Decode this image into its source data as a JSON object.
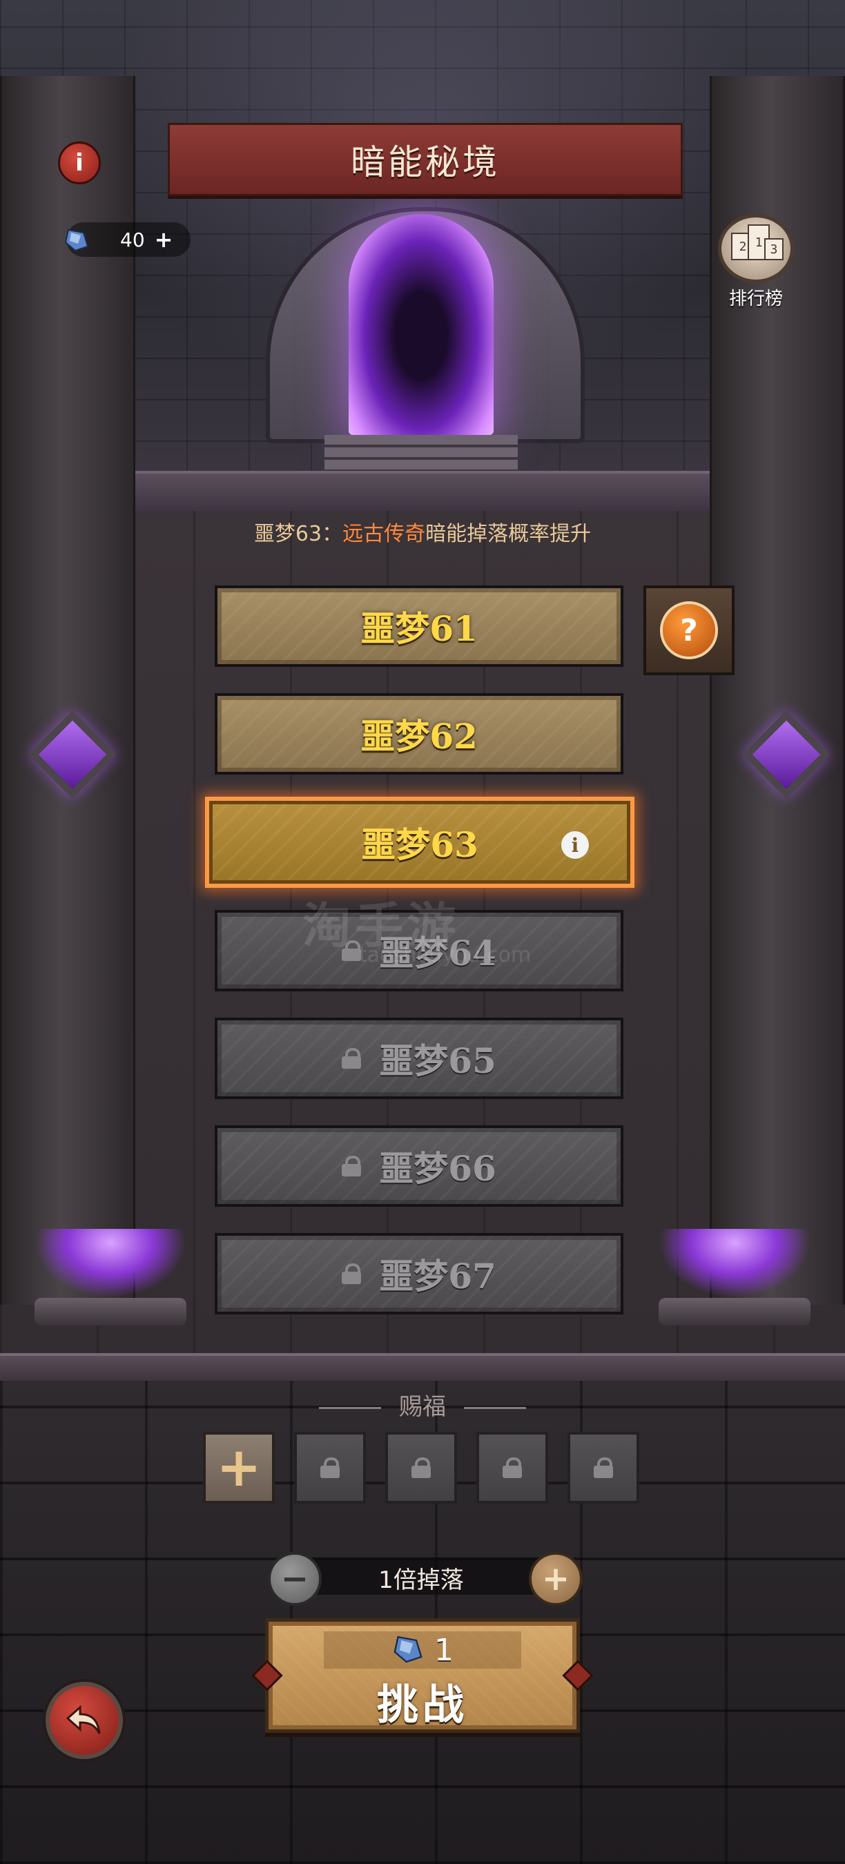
{
  "header": {
    "title": "暗能秘境",
    "info_icon": "info-icon",
    "currency": {
      "icon": "crystal-icon",
      "count": "40",
      "plus": "+"
    },
    "ranking": {
      "label": "排行榜",
      "icon": "ranking-dice-icon"
    }
  },
  "bonus": {
    "prefix": "噩梦63：",
    "highlight": "远古传奇",
    "suffix": "暗能掉落概率提升",
    "highlight_color": "#ff8a3d"
  },
  "levels": [
    {
      "label": "噩梦61",
      "state": "unlocked"
    },
    {
      "label": "噩梦62",
      "state": "unlocked"
    },
    {
      "label": "噩梦63",
      "state": "selected"
    },
    {
      "label": "噩梦64",
      "state": "locked"
    },
    {
      "label": "噩梦65",
      "state": "locked"
    },
    {
      "label": "噩梦66",
      "state": "locked"
    },
    {
      "label": "噩梦67",
      "state": "locked"
    }
  ],
  "help_button": {
    "label": "?"
  },
  "blessing": {
    "title": "赐福",
    "slots": [
      {
        "state": "add",
        "label": "+"
      },
      {
        "state": "locked"
      },
      {
        "state": "locked"
      },
      {
        "state": "locked"
      },
      {
        "state": "locked"
      }
    ]
  },
  "drop_multiplier": {
    "label": "1倍掉落",
    "minus": "−",
    "plus": "+"
  },
  "challenge": {
    "cost": "1",
    "label": "挑战",
    "cost_icon": "crystal-icon"
  },
  "watermark": {
    "main": "淘手游",
    "sub": "taoshouyou.com"
  },
  "colors": {
    "title_banner": "#8e3b35",
    "level_gold_text": "#ffd84a",
    "selected_border": "#ff9a43",
    "portal_purple": "#b06ff0"
  }
}
